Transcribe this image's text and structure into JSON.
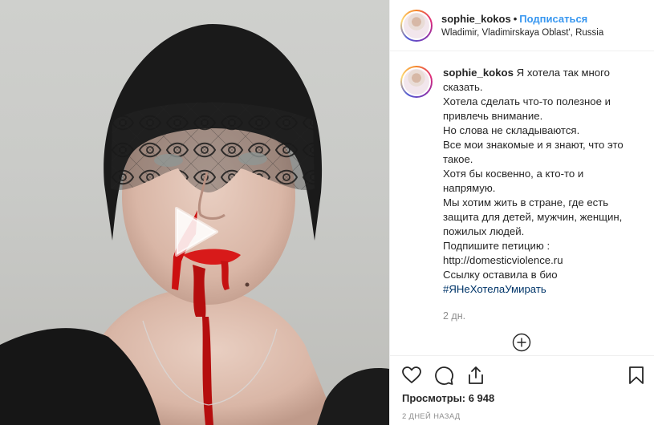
{
  "header": {
    "username": "sophie_kokos",
    "separator": "•",
    "follow_label": "Подписаться",
    "location": "Wladimir, Vladimirskaya Oblast', Russia"
  },
  "caption": {
    "username": "sophie_kokos",
    "lines": [
      "Я хотела так много сказать.",
      "Хотела сделать что-то полезное и привлечь внимание.",
      "Но слова не складываются.",
      "Все мои знакомые и я знают, что это такое.",
      "Хотя бы косвенно, а кто-то и напрямую.",
      "Мы хотим жить в стране, где есть защита для детей, мужчин, женщин, пожилых людей.",
      "Подпишите петицию :",
      "http://domesticviolence.ru",
      "Ссылку оставила в био"
    ],
    "hashtag": "#ЯНеХотелаУмирать",
    "time": "2 дн."
  },
  "icons": {
    "like": "heart-icon",
    "comment": "comment-icon",
    "share": "share-icon",
    "save": "bookmark-icon",
    "load_more": "plus-circle-icon",
    "play": "play-icon"
  },
  "stats": {
    "views_label": "Просмотры:",
    "views_count": "6 948",
    "date": "2 ДНЕЙ НАЗАД"
  },
  "colors": {
    "link": "#3897f0",
    "hashtag": "#003569",
    "muted": "#8e8e8e"
  }
}
